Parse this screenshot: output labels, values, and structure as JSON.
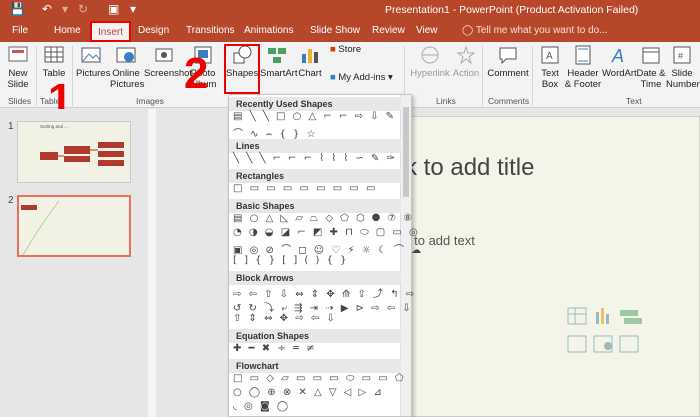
{
  "app": {
    "window_title": "Presentation1 - PowerPoint (Product Activation Failed)"
  },
  "quick_access": {
    "save_icon": "save-icon",
    "undo_icon": "undo-icon",
    "redo_icon": "redo-icon",
    "present_icon": "present-icon"
  },
  "tabs": [
    {
      "label": "File"
    },
    {
      "label": "Home"
    },
    {
      "label": "Insert"
    },
    {
      "label": "Design"
    },
    {
      "label": "Transitions"
    },
    {
      "label": "Animations"
    },
    {
      "label": "Slide Show"
    },
    {
      "label": "Review"
    },
    {
      "label": "View"
    }
  ],
  "tell_me": "Tell me what you want to do...",
  "ribbon": {
    "buttons": [
      {
        "label": "New Slide"
      },
      {
        "label": "Table"
      },
      {
        "label": "Pictures"
      },
      {
        "label": "Online Pictures"
      },
      {
        "label": "Screenshot"
      },
      {
        "label": "Photo Album"
      },
      {
        "label": "Shapes"
      },
      {
        "label": "SmartArt"
      },
      {
        "label": "Chart"
      },
      {
        "label": "Store"
      },
      {
        "label": "My Add-ins"
      },
      {
        "label": "Hyperlink"
      },
      {
        "label": "Action"
      },
      {
        "label": "Comment"
      },
      {
        "label": "Text Box"
      },
      {
        "label": "Header & Footer"
      },
      {
        "label": "WordArt"
      },
      {
        "label": "Date & Time"
      },
      {
        "label": "Slide Number"
      }
    ],
    "groups": [
      "Slides",
      "Tables",
      "Images",
      "Links",
      "Comments",
      "Text"
    ]
  },
  "slides": [
    {
      "number": "1",
      "title_text": "Sorting and ..."
    },
    {
      "number": "2"
    }
  ],
  "placeholders": {
    "title": "ck to add title",
    "body": "k to add text"
  },
  "shapes_menu": {
    "categories": [
      {
        "label": "Recently Used Shapes"
      },
      {
        "label": "Lines"
      },
      {
        "label": "Rectangles"
      },
      {
        "label": "Basic Shapes"
      },
      {
        "label": "Block Arrows"
      },
      {
        "label": "Equation Shapes"
      },
      {
        "label": "Flowchart"
      }
    ]
  },
  "annotations": {
    "step1": "1",
    "step2": "2",
    "highlight_color": "#e00000"
  },
  "colors": {
    "accent": "#b7472a",
    "ribbon_bg": "#f3f3f3"
  }
}
